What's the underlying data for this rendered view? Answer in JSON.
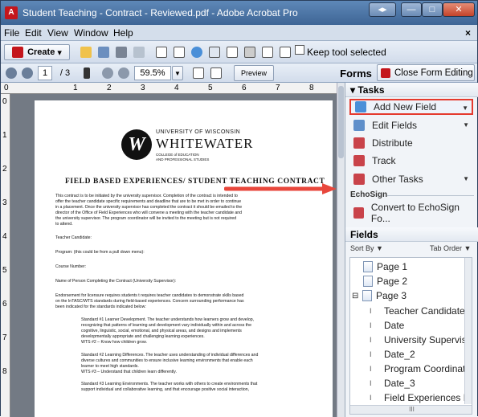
{
  "window": {
    "title": "Student Teaching - Contract - Reviewed.pdf - Adobe Acrobat Pro",
    "app_icon": "acrobat-icon",
    "controls": [
      "◂▸",
      "—",
      "□",
      "✕"
    ]
  },
  "menu": {
    "items": [
      "File",
      "Edit",
      "View",
      "Window",
      "Help"
    ],
    "close_glyph": "×"
  },
  "toolbar": {
    "create_label": "Create",
    "keep_tool_label": "Keep tool selected",
    "page_current": "1",
    "page_total": "/ 3",
    "zoom": "59.5%",
    "preview_label": "Preview",
    "forms_label": "Forms",
    "close_form_label": "Close Form Editing"
  },
  "ruler": {
    "top_marks": [
      "0",
      "1",
      "2",
      "3",
      "4",
      "5",
      "6",
      "7",
      "8"
    ],
    "left_marks": [
      "0",
      "1",
      "2",
      "3",
      "4",
      "5",
      "6",
      "7",
      "8"
    ]
  },
  "document": {
    "uni_line1": "UNIVERSITY OF WISCONSIN",
    "uni_line2": "WHITEWATER",
    "uni_line3": "COLLEGE of EDUCATION\nAND PROFESSIONAL STUDIES",
    "heading": "FIELD BASED EXPERIENCES/ STUDENT TEACHING CONTRACT",
    "intro": "This contract is to be initiated by the university supervisor.  Completion of the contract is intended to\noffer the teacher candidate specific requirements and deadline that are to be met in order to continue\nin a placement.  Once the university supervisor has completed the contract it should be emailed to the\ndirector of the Office of Field Experiences who will convene a meeting with the teacher candidate and\nthe university supervisor.  The program coordinator will be invited to the meeting but is not required\nto attend.",
    "teacher_candidate": "Teacher Candidate:",
    "program": "Program:  (this could be from a pull down menu):",
    "course": "Course Number:",
    "person": "Name of Person Completing the Contract (University Supervisor):",
    "endorsement": "Endorsement for licensure requires students t requires teacher candidates to demonstrate skills based\non the InTASC/WTS standards during field-based experiences.  Concern surrounding performance has\nbeen indicated for the standards indicated below:",
    "std1": "Standard #1 Learner Development. The teacher understands how learners grow and develop,\nrecognizing that patterns of learning and development vary individually within and across the\ncognitive, linguistic, social, emotional, and physical areas, and designs and implements\ndevelopmentally appropriate and challenging learning experiences.\nWTS #2 – Know how children grow.",
    "std2": "Standard #2 Learning Differences. The teacher uses understanding of individual differences and\ndiverse cultures and communities to ensure inclusive learning environments that enable each\nlearner to meet high standards.\nWTS #3 – Understand that children learn differently.",
    "std3": "Standard #3 Learning Environments. The teacher works with others to create environments that\nsupport individual and collaborative learning, and that encourage positive social interaction,"
  },
  "tasks": {
    "header": "Tasks",
    "items": [
      {
        "label": "Add New Field",
        "icon": "add-field-icon",
        "caret": "▼"
      },
      {
        "label": "Edit Fields",
        "icon": "edit-fields-icon",
        "caret": "▼"
      },
      {
        "label": "Distribute",
        "icon": "distribute-icon",
        "caret": ""
      },
      {
        "label": "Track",
        "icon": "track-icon",
        "caret": ""
      },
      {
        "label": "Other Tasks",
        "icon": "other-tasks-icon",
        "caret": "▼"
      }
    ],
    "echosign_header": "EchoSign",
    "echosign_item": "Convert to EchoSign Fo..."
  },
  "fields": {
    "header": "Fields",
    "sort_by": "Sort By ▼",
    "tab_order": "Tab Order ▼",
    "pages": [
      "Page 1",
      "Page 2",
      "Page 3"
    ],
    "expander": "⊟",
    "items": [
      "Teacher Candidate",
      "Date",
      "University Supervisor",
      "Date_2",
      "Program Coordinator",
      "Date_3",
      "Field Experiences Repr"
    ],
    "hscroll_thumb": "III"
  },
  "colors": {
    "highlight": "#e53a2e",
    "arrow": "#e8473c"
  }
}
